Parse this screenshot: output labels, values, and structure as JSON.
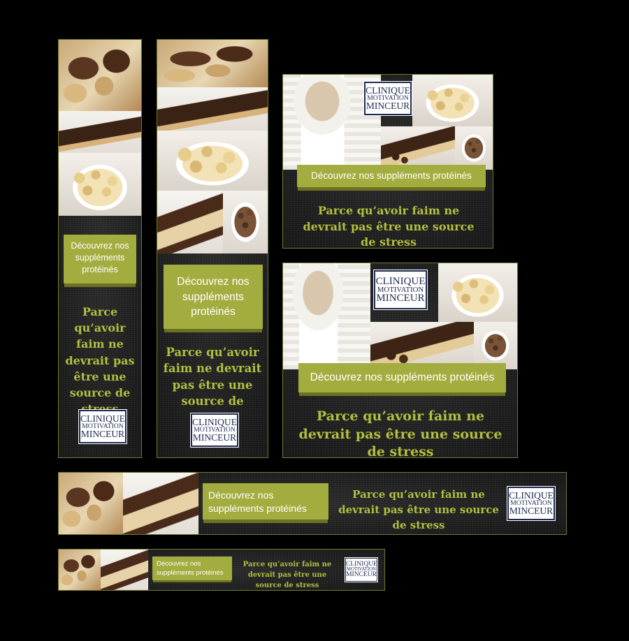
{
  "brand": {
    "logo_line1": "CLINIQUE",
    "logo_line2": "MOTIVATION",
    "logo_line3": "MINCEUR"
  },
  "cta": {
    "label": "Découvrez nos suppléments protéinés"
  },
  "tagline": {
    "text": "Parce qu’avoir faim ne devrait pas être une source de stress"
  },
  "colors": {
    "background": "#000000",
    "accent_green": "#a3ad3f",
    "tagline_green": "#b3bf3e",
    "logo_navy": "#1d2b52",
    "banner_bg": "#1c1c1c"
  }
}
